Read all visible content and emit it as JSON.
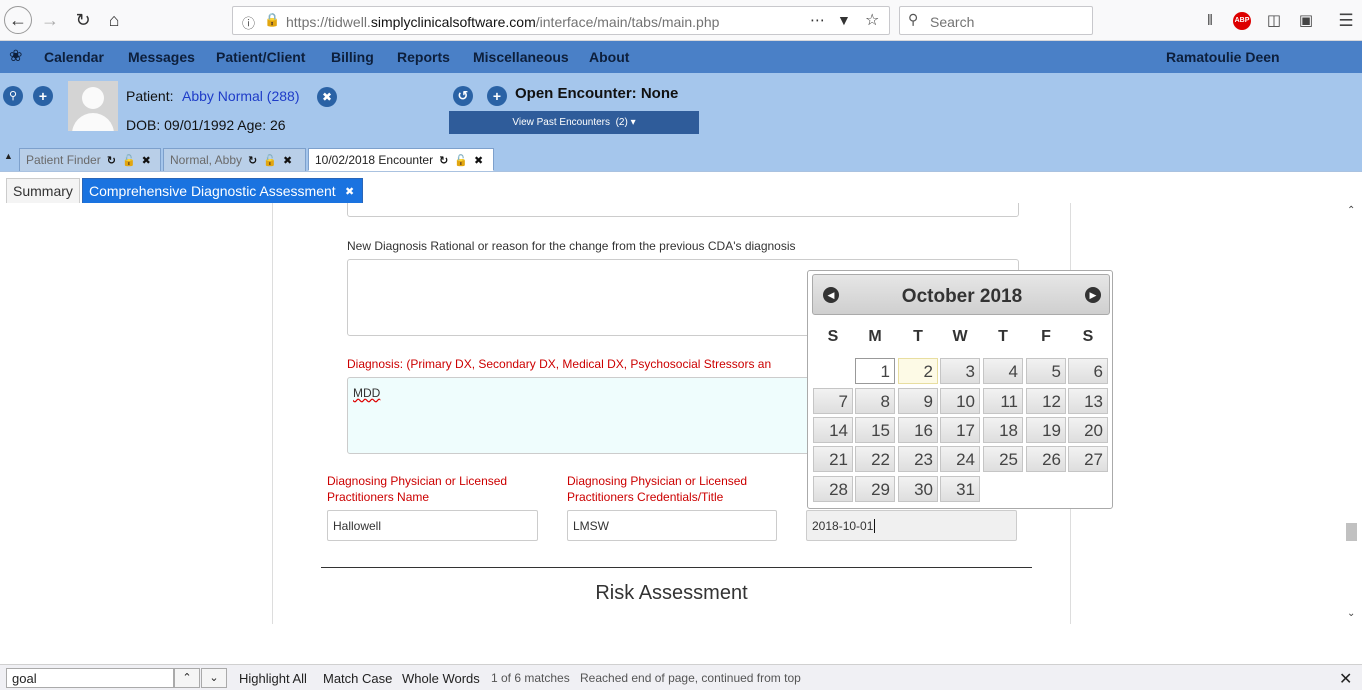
{
  "browser": {
    "url_prefix": "https://tidwell.",
    "url_domain": "simplyclinicalsoftware.com",
    "url_path": "/interface/main/tabs/main.php",
    "search_placeholder": "Search",
    "icons": [
      "back-icon",
      "forward-icon",
      "reload-icon",
      "home-icon",
      "info-icon",
      "lock-icon",
      "more-icon",
      "pocket-icon",
      "bookmark-star-icon",
      "library-icon",
      "adblock-icon",
      "sidebar-icon",
      "screenshot-icon",
      "hamburger-menu-icon"
    ]
  },
  "menu": {
    "items": [
      "Calendar",
      "Messages",
      "Patient/Client",
      "Billing",
      "Reports",
      "Miscellaneous",
      "About"
    ],
    "user": "Ramatoulie Deen"
  },
  "patient": {
    "label": "Patient:",
    "name": "Abby Normal (288)",
    "dob_line": "DOB: 09/01/1992 Age: 26",
    "encounter": "Open Encounter: None",
    "view_past": "View Past Encounters",
    "past_count": "(2)"
  },
  "tabs": [
    {
      "label": "Patient Finder"
    },
    {
      "label": "Normal, Abby"
    },
    {
      "label": "10/02/2018 Encounter"
    }
  ],
  "subtabs": {
    "summary": "Summary",
    "active": "Comprehensive Diagnostic Assessment"
  },
  "form": {
    "rational_label": "New Diagnosis Rational or reason for the change from the previous CDA's diagnosis",
    "diagnosis_label": "Diagnosis: (Primary DX, Secondary DX, Medical DX, Psychosocial Stressors an",
    "diagnosis_value": "MDD",
    "physician_name_label_1": "Diagnosing Physician or Licensed",
    "physician_name_label_2": "Practitioners Name",
    "physician_name_value": "Hallowell",
    "credentials_label_1": "Diagnosing Physician or Licensed",
    "credentials_label_2": "Practitioners Credentials/Title",
    "credentials_value": "LMSW",
    "date_value": "2018-10-01",
    "risk_heading": "Risk Assessment"
  },
  "datepicker": {
    "title": "October 2018",
    "dow": [
      "S",
      "M",
      "T",
      "W",
      "T",
      "F",
      "S"
    ],
    "first_weekday": 1,
    "days_in_month": 31,
    "today": 2,
    "selected": 1
  },
  "findbar": {
    "query": "goal",
    "highlight_all": "Highlight All",
    "match_case": "Match Case",
    "whole_words": "Whole Words",
    "matches": "1 of 6 matches",
    "status": "Reached end of page, continued from top"
  },
  "colors": {
    "menu_bar": "#4a80c7",
    "header": "#a5c6ec",
    "active_subtab": "#1a73e0",
    "required_label": "#cc0000"
  }
}
